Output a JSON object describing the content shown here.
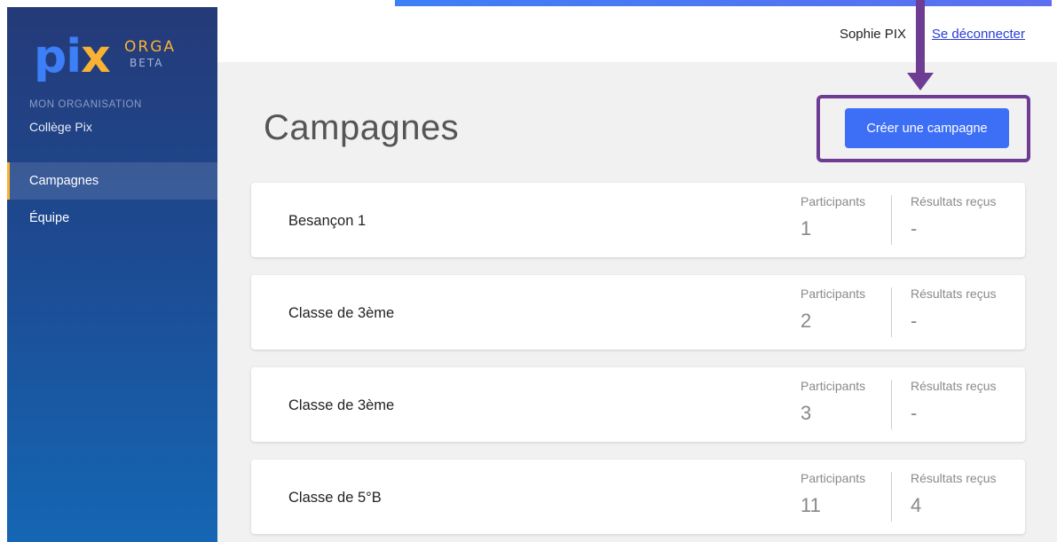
{
  "app": {
    "logo_pix_p": "p",
    "logo_pix_i": "i",
    "logo_pix_x": "x",
    "logo_orga": "ORGA",
    "logo_beta": "BETA"
  },
  "sidebar": {
    "org_caption": "MON ORGANISATION",
    "org_name": "Collège Pix",
    "items": [
      {
        "label": "Campagnes",
        "active": true
      },
      {
        "label": "Équipe",
        "active": false
      }
    ]
  },
  "header": {
    "user_name": "Sophie PIX",
    "logout_label": "Se déconnecter"
  },
  "main": {
    "title": "Campagnes",
    "create_button_label": "Créer une campagne",
    "campaigns": [
      {
        "name": "Besançon 1",
        "participants_label": "Participants",
        "participants": "1",
        "results_label": "Résultats reçus",
        "results": "-"
      },
      {
        "name": "Classe de 3ème",
        "participants_label": "Participants",
        "participants": "2",
        "results_label": "Résultats reçus",
        "results": "-"
      },
      {
        "name": "Classe de 3ème",
        "participants_label": "Participants",
        "participants": "3",
        "results_label": "Résultats reçus",
        "results": "-"
      },
      {
        "name": "Classe de 5°B",
        "participants_label": "Participants",
        "participants": "11",
        "results_label": "Résultats reçus",
        "results": "4"
      }
    ]
  },
  "colors": {
    "accent": "#3d6ff6",
    "logo_yellow": "#f9b233",
    "annotation_purple": "#6e3c92"
  }
}
